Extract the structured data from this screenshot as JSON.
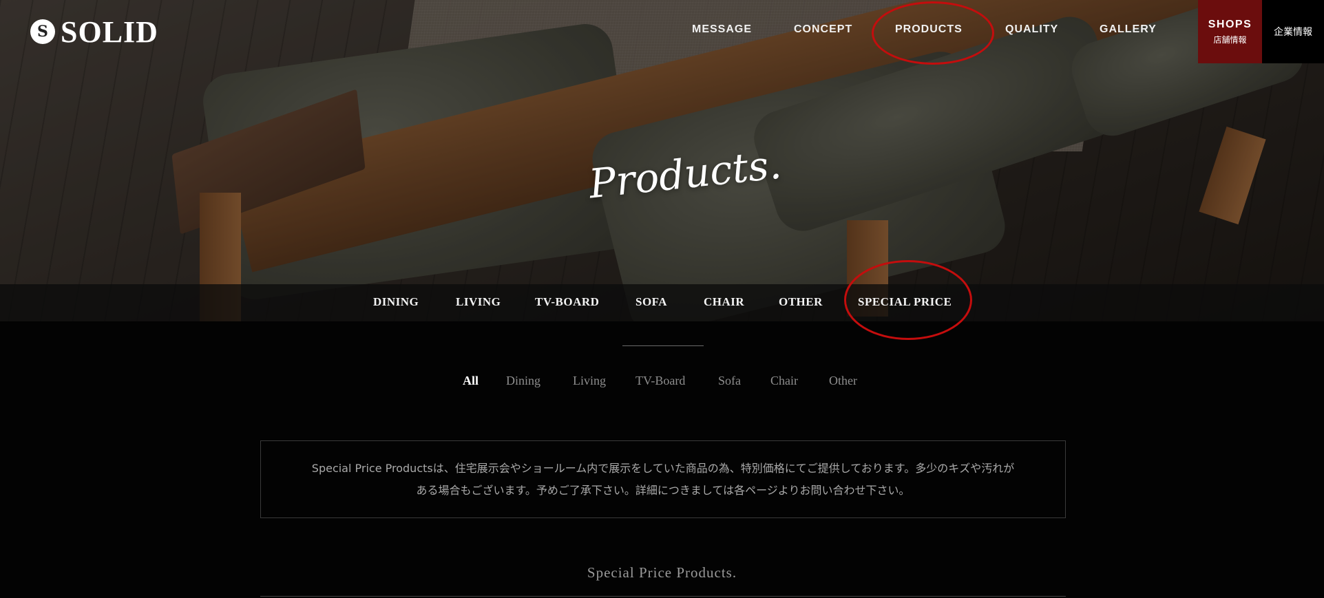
{
  "brand": {
    "logo_mark": "S",
    "name": "SOLID"
  },
  "topnav": [
    "MESSAGE",
    "CONCEPT",
    "PRODUCTS",
    "QUALITY",
    "GALLERY"
  ],
  "shops": {
    "label_en": "SHOPS",
    "label_ja": "店舗情報"
  },
  "corporate_label": "企業情報",
  "hero_title": "Products.",
  "categories": [
    "DINING",
    "LIVING",
    "TV-BOARD",
    "SOFA",
    "CHAIR",
    "OTHER",
    "SPECIAL PRICE"
  ],
  "filters": {
    "items": [
      "All",
      "Dining",
      "Living",
      "TV-Board",
      "Sofa",
      "Chair",
      "Other"
    ],
    "active": "All"
  },
  "notice": {
    "line1": "Special Price Productsは、住宅展示会やショールーム内で展示をしていた商品の為、特別価格にてご提供しております。多少のキズや汚れが",
    "line2": "ある場合もございます。予めご了承下さい。詳細につきましては各ページよりお問い合わせ下さい。"
  },
  "section_title": "Special Price Products.",
  "colors": {
    "shops_bg": "#6b0d0d",
    "annotation": "#c40d0d",
    "page_bg": "#030303"
  }
}
